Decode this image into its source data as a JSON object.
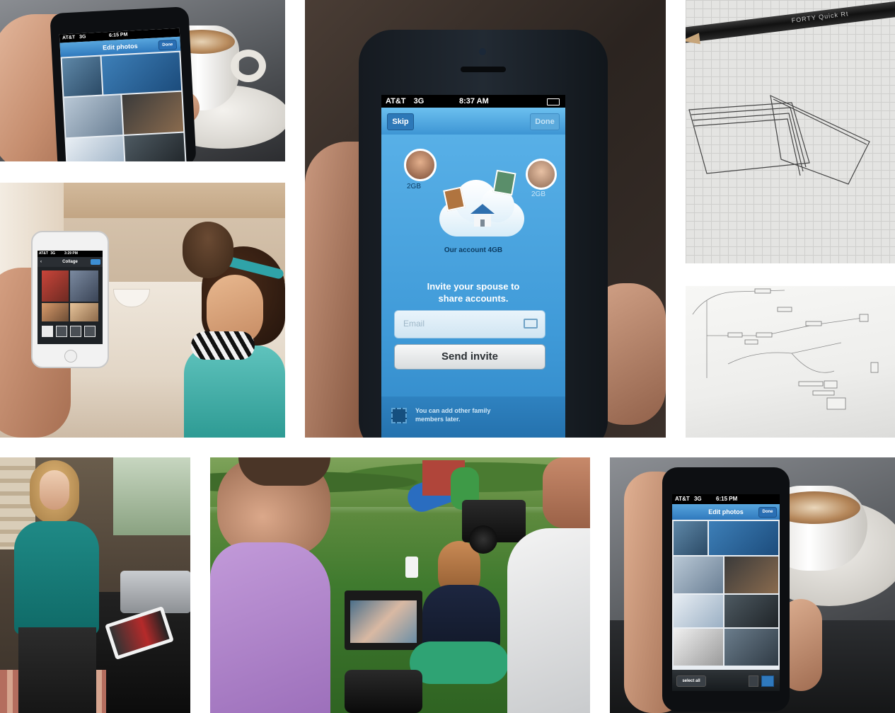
{
  "photo_top_left": {
    "status": {
      "carrier": "AT&T",
      "network": "3G",
      "time": "6:15 PM"
    },
    "nav": {
      "title": "Edit photos",
      "done": "Done"
    }
  },
  "photo_kitchen": {
    "status": {
      "carrier": "AT&T",
      "network": "3G",
      "time": "3:29 PM"
    },
    "nav": {
      "title": "Collage"
    }
  },
  "photo_center": {
    "status": {
      "carrier": "AT&T",
      "network": "3G",
      "time": "8:37 AM"
    },
    "nav": {
      "skip": "Skip",
      "done": "Done"
    },
    "left_user_quota": "2GB",
    "right_user_quota": "2GB",
    "account_label": "Our account 4GB",
    "invite_heading_line1": "Invite your spouse to",
    "invite_heading_line2": "share accounts.",
    "email_placeholder": "Email",
    "send_invite": "Send invite",
    "footer_line1": "You can add other family",
    "footer_line2": "members later."
  },
  "photo_sketch": {
    "pencil_text": "FORTY Quick Rt"
  },
  "photo_bottom_right": {
    "status": {
      "carrier": "AT&T",
      "network": "3G",
      "time": "6:15 PM"
    },
    "nav": {
      "title": "Edit photos",
      "done": "Done"
    },
    "toolbar": {
      "select_all": "select all"
    }
  },
  "colors": {
    "ios_blue": "#3a8fd0",
    "nav_blue": "#2f79bd",
    "grass": "#3f7a2e",
    "sky_blue": "#5fb2e4"
  }
}
